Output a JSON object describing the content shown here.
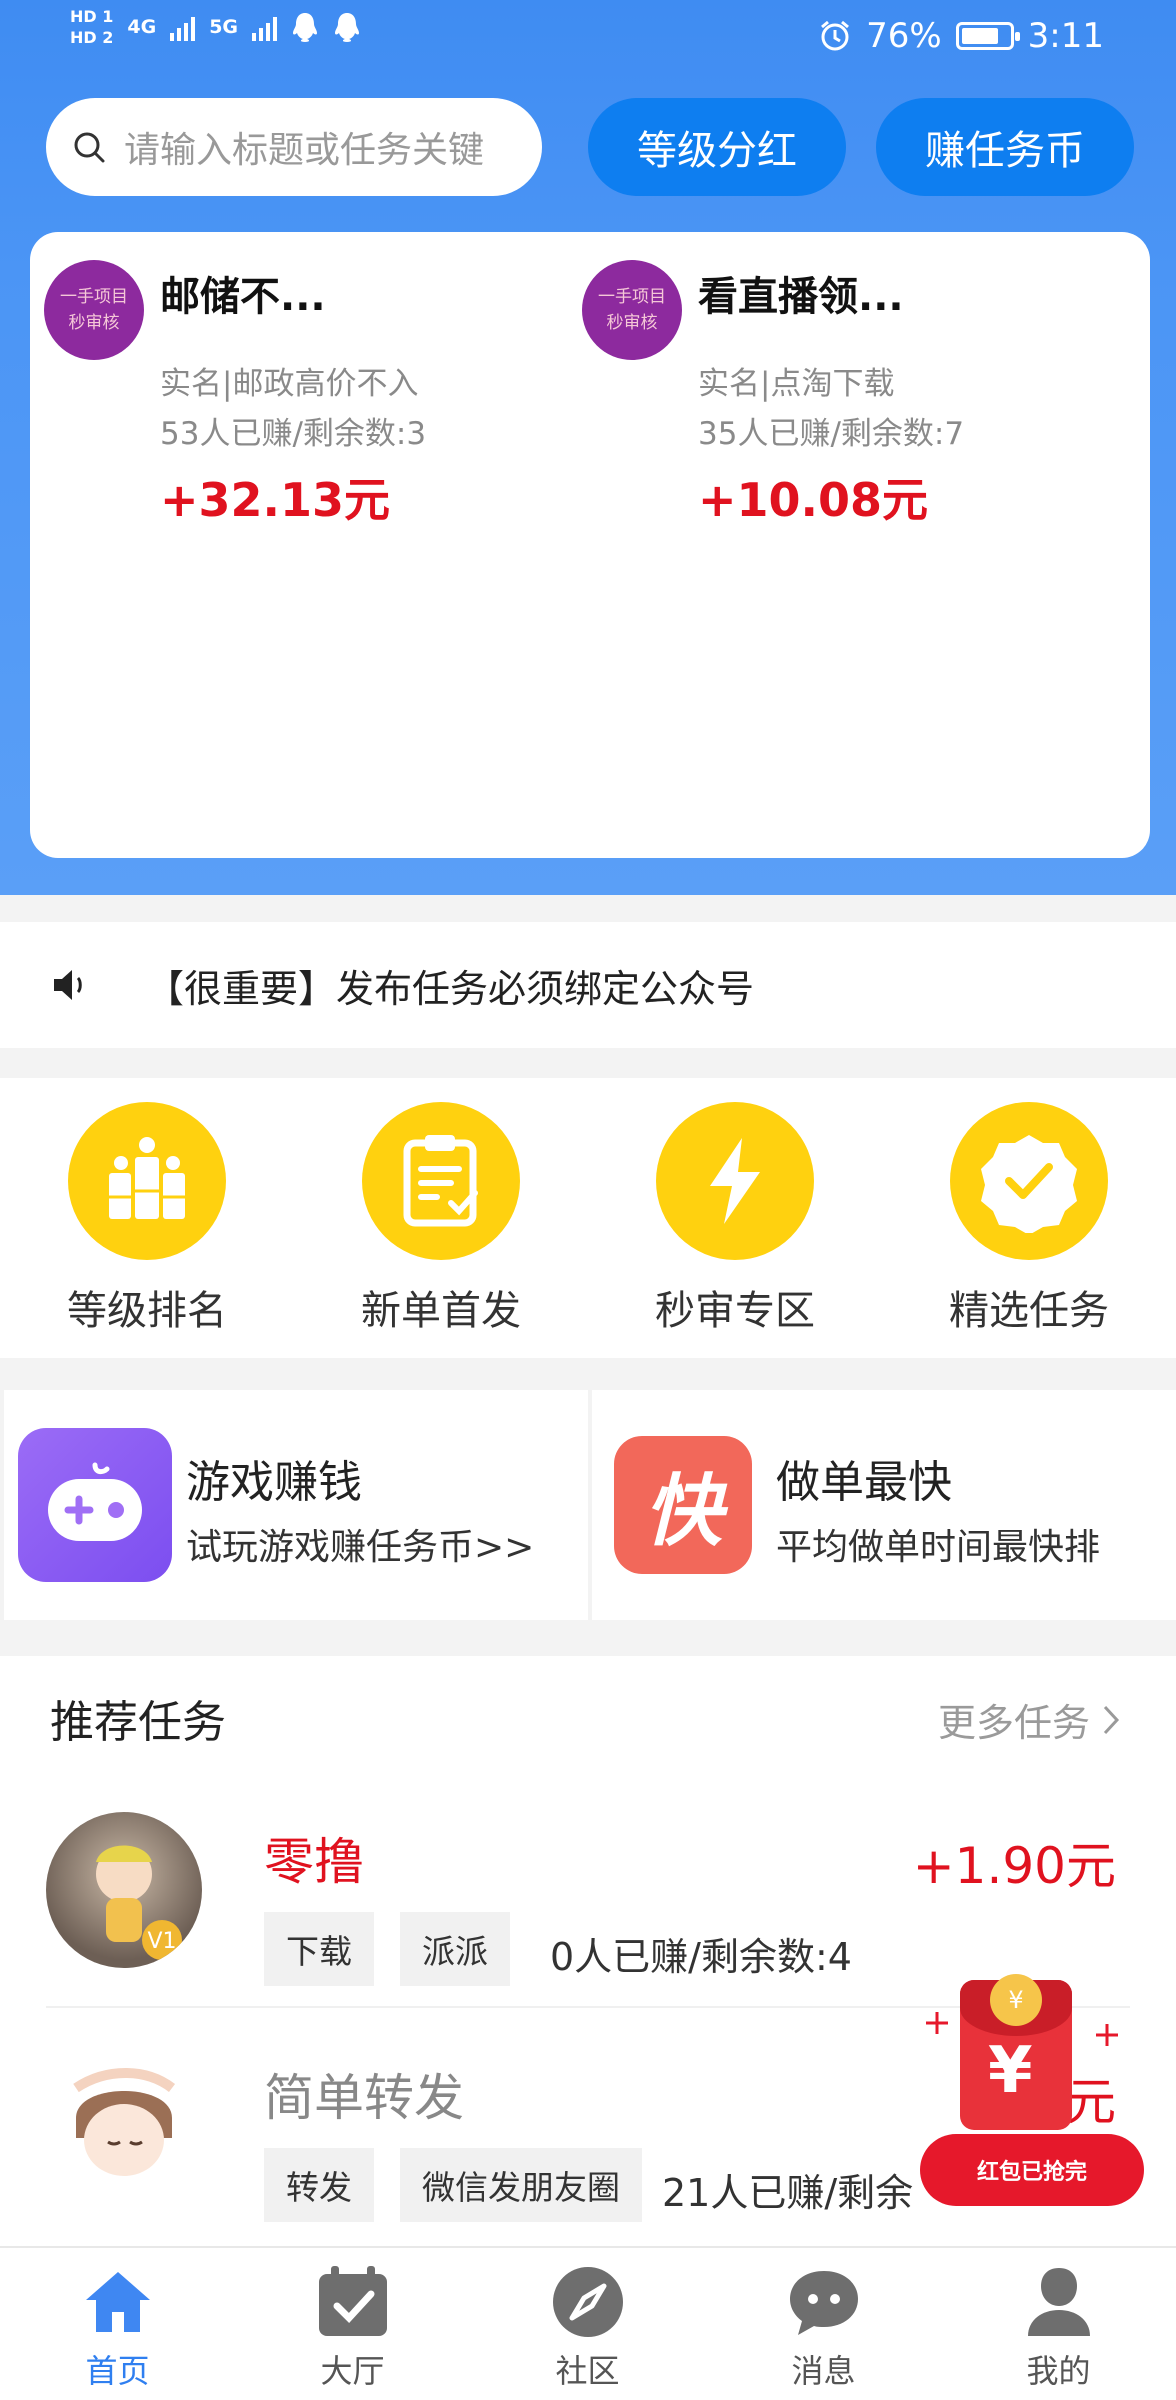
{
  "status_bar": {
    "hd1": "HD 1",
    "hd2": "HD 2",
    "net1": "4G",
    "net2": "5G",
    "battery": "76%",
    "time": "3:11"
  },
  "search": {
    "placeholder": "请输入标题或任务关键"
  },
  "header_buttons": {
    "dividend": "等级分红",
    "earn_coins": "赚任务币"
  },
  "featured": [
    {
      "badge_line1": "一手项目",
      "badge_line2": "秒审核",
      "title": "邮储不...",
      "desc": "实名|邮政高价不入",
      "stats": "53人已赚/剩余数:3",
      "price": "+32.13元"
    },
    {
      "badge_line1": "一手项目",
      "badge_line2": "秒审核",
      "title": "看直播领...",
      "desc": "实名|点淘下载",
      "stats": "35人已赚/剩余数:7",
      "price": "+10.08元"
    }
  ],
  "notice": {
    "text": "【很重要】发布任务必须绑定公众号"
  },
  "categories": [
    {
      "label": "等级排名",
      "icon": "ranking-icon"
    },
    {
      "label": "新单首发",
      "icon": "clipboard-icon"
    },
    {
      "label": "秒审专区",
      "icon": "lightning-icon"
    },
    {
      "label": "精选任务",
      "icon": "check-badge-icon"
    }
  ],
  "promos": [
    {
      "title": "游戏赚钱",
      "subtitle": "试玩游戏赚任务币>>",
      "icon": "gamepad-icon"
    },
    {
      "title": "做单最快",
      "icon_text": "快",
      "subtitle": "平均做单时间最快排",
      "icon": "fast-icon"
    }
  ],
  "recommended": {
    "title": "推荐任务",
    "more": "更多任务",
    "items": [
      {
        "title": "零撸",
        "title_color": "#e0121f",
        "tags": [
          "下载",
          "派派"
        ],
        "stats": "0人已赚/剩余数:4",
        "price": "+1.90元",
        "level_badge": "V1"
      },
      {
        "title": "简单转发",
        "title_color": "#888888",
        "tags": [
          "转发",
          "微信发朋友圈"
        ],
        "stats": "21人已赚/剩余",
        "price": "+",
        "price_tail": "元"
      }
    ]
  },
  "red_packet": {
    "label": "红包已抢完",
    "symbol": "¥"
  },
  "tabbar": [
    {
      "label": "首页",
      "icon": "home-icon",
      "active": true
    },
    {
      "label": "大厅",
      "icon": "calendar-check-icon",
      "active": false
    },
    {
      "label": "社区",
      "icon": "compass-icon",
      "active": false
    },
    {
      "label": "消息",
      "icon": "chat-bubble-icon",
      "active": false
    },
    {
      "label": "我的",
      "icon": "user-icon",
      "active": false
    }
  ],
  "colors": {
    "primary": "#0e7ef0",
    "hero": "#4b95f5",
    "price_red": "#e0121f",
    "category_yellow": "#ffd10f"
  }
}
